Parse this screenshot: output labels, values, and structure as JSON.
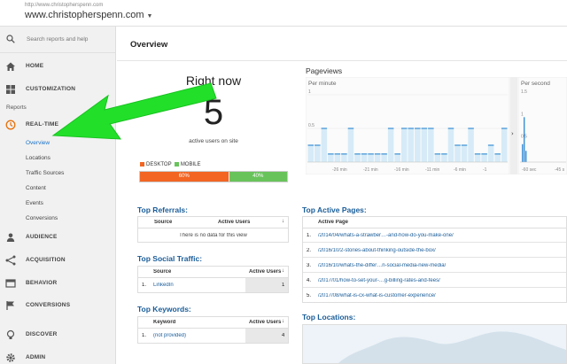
{
  "header": {
    "account_url": "http://www.christopherspenn.com",
    "property": "www.christopherspenn.com"
  },
  "sidebar": {
    "search_placeholder": "Search reports and help",
    "home": "HOME",
    "customization": "CUSTOMIZATION",
    "reports_label": "Reports",
    "realtime": "REAL-TIME",
    "realtime_items": [
      "Overview",
      "Locations",
      "Traffic Sources",
      "Content",
      "Events",
      "Conversions"
    ],
    "audience": "AUDIENCE",
    "acquisition": "ACQUISITION",
    "behavior": "BEHAVIOR",
    "conversions": "CONVERSIONS",
    "discover": "DISCOVER",
    "admin": "ADMIN"
  },
  "main": {
    "title": "Overview",
    "right_now": {
      "title": "Right now",
      "count": "5",
      "label": "active users on site"
    },
    "devices": {
      "desktop_label": "DESKTOP",
      "mobile_label": "MOBILE",
      "desktop_pct": "60%",
      "mobile_pct": "40%",
      "desktop_value": 60,
      "mobile_value": 40,
      "desktop_color": "#f26522",
      "mobile_color": "#69c35b"
    },
    "pageviews": {
      "title": "Pageviews",
      "per_minute": "Per minute",
      "per_second": "Per second",
      "y_ticks_minute": [
        "1",
        "0.5"
      ],
      "y_ticks_second": [
        "1.5",
        "1",
        "0.5"
      ],
      "x_ticks_minute": [
        "-26 min",
        "-21 min",
        "-16 min",
        "-11 min",
        "-6 min",
        "-1"
      ],
      "x_ticks_second": [
        "-60 sec",
        "-45 s"
      ],
      "minute_values": [
        0.25,
        0.25,
        0.5,
        0.12,
        0.12,
        0.12,
        0.5,
        0.12,
        0.12,
        0.12,
        0.12,
        0.12,
        0.5,
        0.12,
        0.5,
        0.5,
        0.5,
        0.5,
        0.5,
        0.12,
        0.12,
        0.5,
        0.25,
        0.25,
        0.5,
        0.12,
        0.12,
        0.25,
        0.12,
        0.5
      ]
    },
    "top_referrals": {
      "title": "Top Referrals:",
      "col_source": "Source",
      "col_users": "Active Users",
      "empty": "There is no data for this view"
    },
    "top_social": {
      "title": "Top Social Traffic:",
      "col_source": "Source",
      "col_users": "Active Users",
      "rows": [
        {
          "idx": "1.",
          "source": "LinkedIn",
          "users": "1"
        }
      ]
    },
    "top_keywords": {
      "title": "Top Keywords:",
      "col_keyword": "Keyword",
      "col_users": "Active Users",
      "rows": [
        {
          "idx": "1.",
          "keyword": "(not provided)",
          "users": "4"
        }
      ]
    },
    "top_pages": {
      "title": "Top Active Pages:",
      "col_page": "Active Page",
      "rows": [
        {
          "idx": "1.",
          "page": "/2014/04/whats-a-strawber…-and-how-do-you-make-one/"
        },
        {
          "idx": "2.",
          "page": "/2016/10/2-stories-about-thinking-outside-the-box/"
        },
        {
          "idx": "3.",
          "page": "/2016/10/whats-the-differ…n-social-media-new-media/"
        },
        {
          "idx": "4.",
          "page": "/2017/01/how-to-set-your-…g-billing-rates-and-fees/"
        },
        {
          "idx": "5.",
          "page": "/2017/08/what-is-cx-what-is-customer-experience/"
        }
      ]
    },
    "top_locations": {
      "title": "Top Locations:"
    }
  }
}
